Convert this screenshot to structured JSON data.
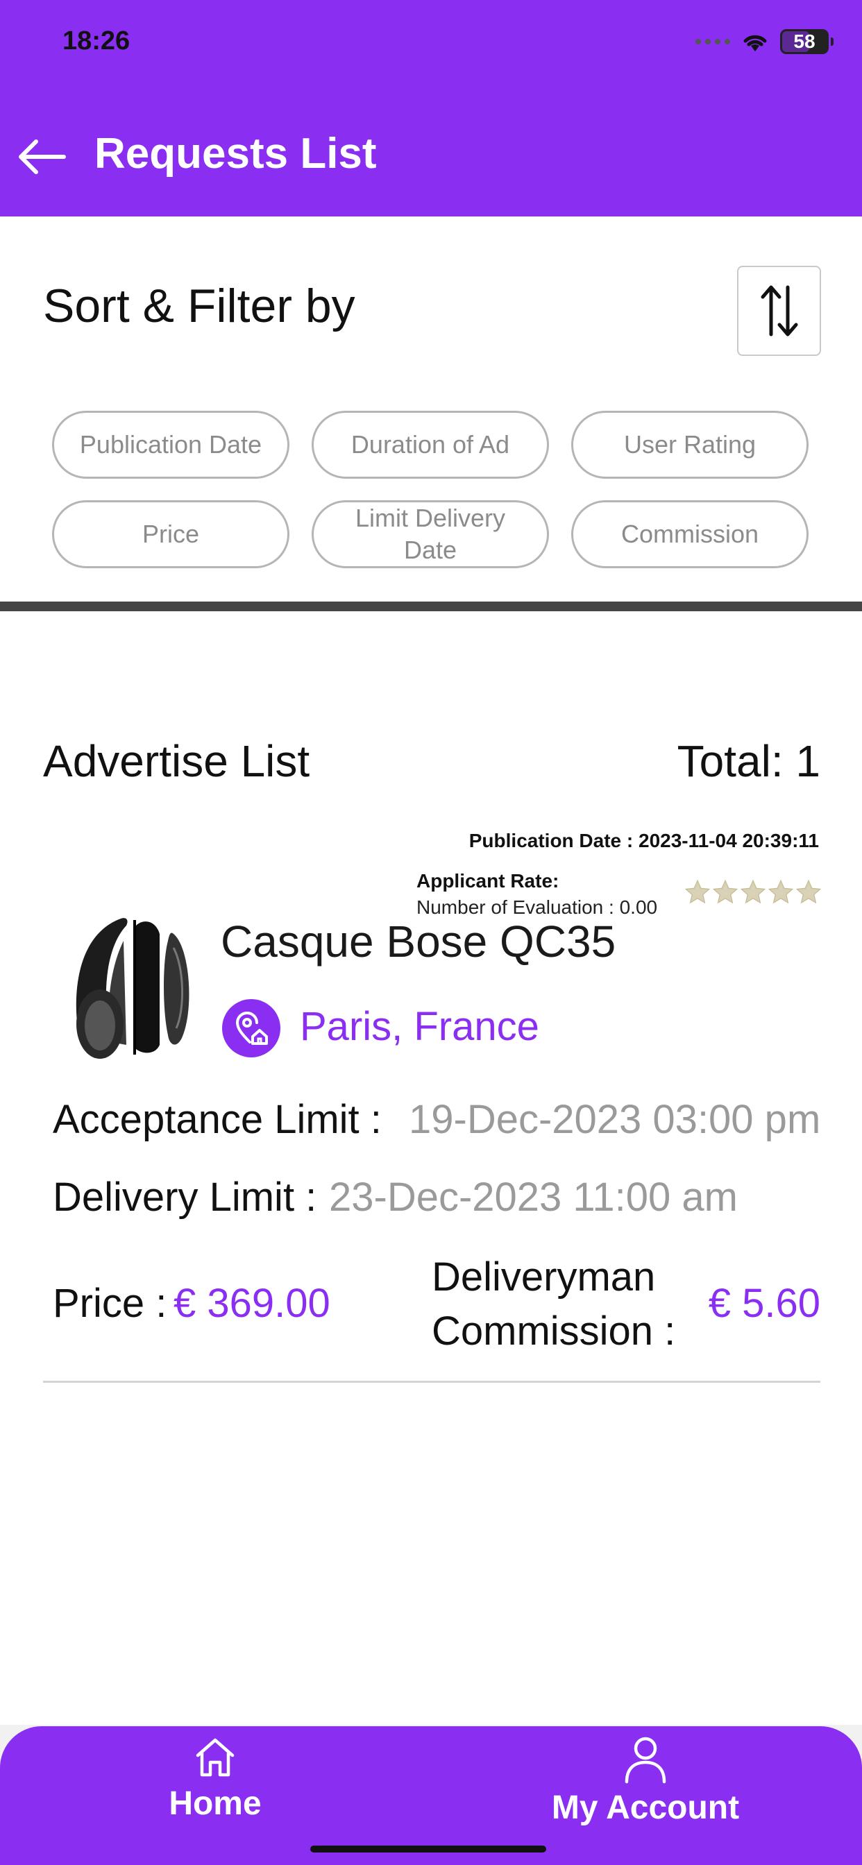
{
  "status_bar": {
    "time": "18:26",
    "battery": "58"
  },
  "header": {
    "title": "Requests List"
  },
  "sort_filter": {
    "title": "Sort & Filter by",
    "chips": [
      "Publication Date",
      "Duration of Ad",
      "User Rating",
      "Price",
      "Limit Delivery Date",
      "Commission"
    ]
  },
  "advertise": {
    "title": "Advertise List",
    "total": "Total: 1",
    "item": {
      "publication_date": "Publication Date : 2023-11-04 20:39:11",
      "applicant_rate_label": "Applicant Rate:",
      "evaluation": "Number of Evaluation : 0.00",
      "rating": 0,
      "rating_max": 5,
      "name": "Casque Bose QC35",
      "location": "Paris, France",
      "acceptance_label": "Acceptance Limit :",
      "acceptance_value": "19-Dec-2023 03:00 pm",
      "delivery_label": "Delivery Limit :",
      "delivery_value": "23-Dec-2023 11:00 am",
      "price_label": "Price :",
      "price_value": "€ 369.00",
      "commission_label_line1": "Deliveryman",
      "commission_label_line2": "Commission :",
      "commission_value": "€ 5.60"
    }
  },
  "bottom_nav": {
    "home": "Home",
    "account": "My Account"
  },
  "colors": {
    "accent": "#8a2ef2",
    "muted_text": "#9a9a9a",
    "chip_border": "#b5b5b5"
  }
}
